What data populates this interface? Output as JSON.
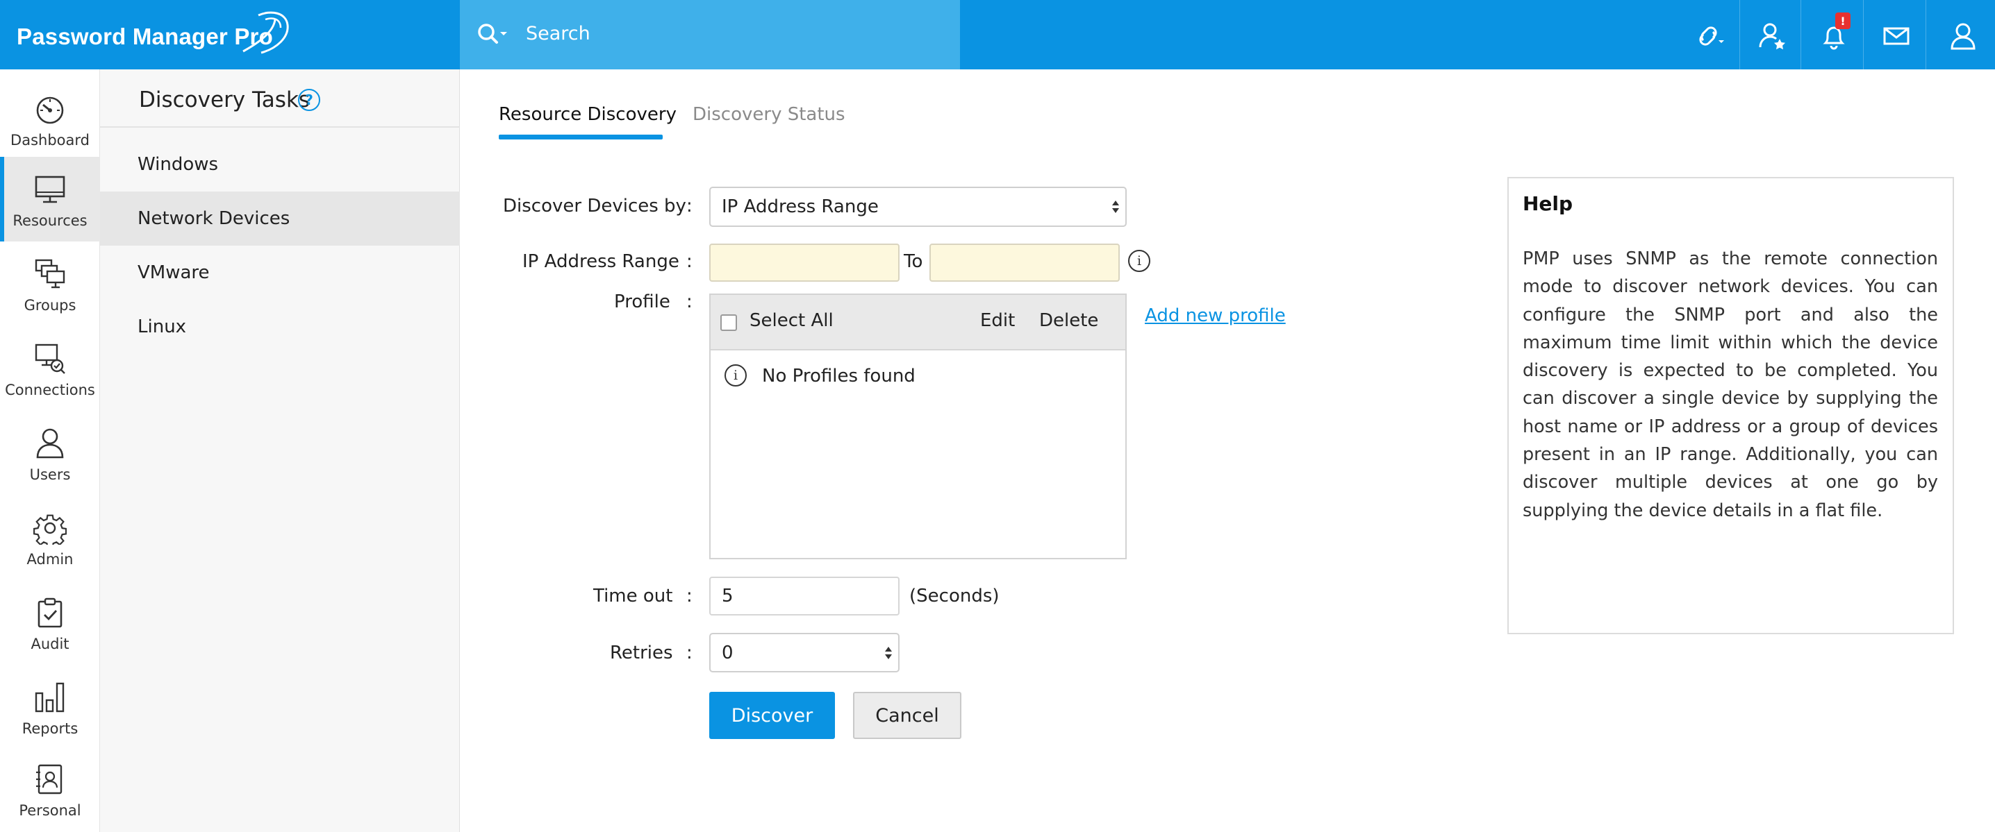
{
  "app": {
    "title": "Password Manager Pro"
  },
  "search": {
    "placeholder": "Search"
  },
  "topbar": {
    "icons": [
      "link-icon",
      "user-star-icon",
      "bell-icon",
      "mail-icon",
      "user-icon"
    ],
    "notification_badge": "!"
  },
  "nav": {
    "items": [
      {
        "label": "Dashboard",
        "icon": "dashboard-icon"
      },
      {
        "label": "Resources",
        "icon": "monitor-icon",
        "active": true
      },
      {
        "label": "Groups",
        "icon": "groups-icon"
      },
      {
        "label": "Connections",
        "icon": "connections-icon"
      },
      {
        "label": "Users",
        "icon": "user-icon"
      },
      {
        "label": "Admin",
        "icon": "gear-icon"
      },
      {
        "label": "Audit",
        "icon": "clipboard-check-icon"
      },
      {
        "label": "Reports",
        "icon": "bar-chart-icon"
      },
      {
        "label": "Personal",
        "icon": "contact-card-icon"
      }
    ]
  },
  "subpanel": {
    "title": "Discovery Tasks",
    "help": "?",
    "items": [
      {
        "label": "Windows"
      },
      {
        "label": "Network Devices",
        "active": true
      },
      {
        "label": "VMware"
      },
      {
        "label": "Linux"
      }
    ]
  },
  "tabs": [
    {
      "label": "Resource Discovery",
      "active": true
    },
    {
      "label": "Discovery Status"
    }
  ],
  "form": {
    "colon": ":",
    "discover_by": {
      "label": "Discover Devices by",
      "value": "IP Address Range"
    },
    "ip_range": {
      "label": "IP Address Range",
      "from": "",
      "to_label": "To",
      "to": ""
    },
    "profile": {
      "label": "Profile",
      "select_all": "Select All",
      "edit": "Edit",
      "delete": "Delete",
      "empty": "No Profiles found",
      "add_link": "Add new profile"
    },
    "timeout": {
      "label": "Time out",
      "value": "5",
      "unit": "(Seconds)"
    },
    "retries": {
      "label": "Retries",
      "value": "0"
    },
    "discover_button": "Discover",
    "cancel_button": "Cancel"
  },
  "help": {
    "title": "Help",
    "text": "PMP uses SNMP as the remote connection mode to discover network devices. You can configure the SNMP port and also the maximum time limit within which the device discovery is expected to be completed. You can discover a single device by supplying the host name or IP address or a group of devices present in an IP range. Additionally, you can discover multiple devices at one go by supplying the device details in a flat file."
  },
  "colors": {
    "accent": "#0a93e2",
    "search_bg": "#3fb0ea",
    "input_highlight": "#fdf8dd",
    "badge": "#e8312f"
  }
}
